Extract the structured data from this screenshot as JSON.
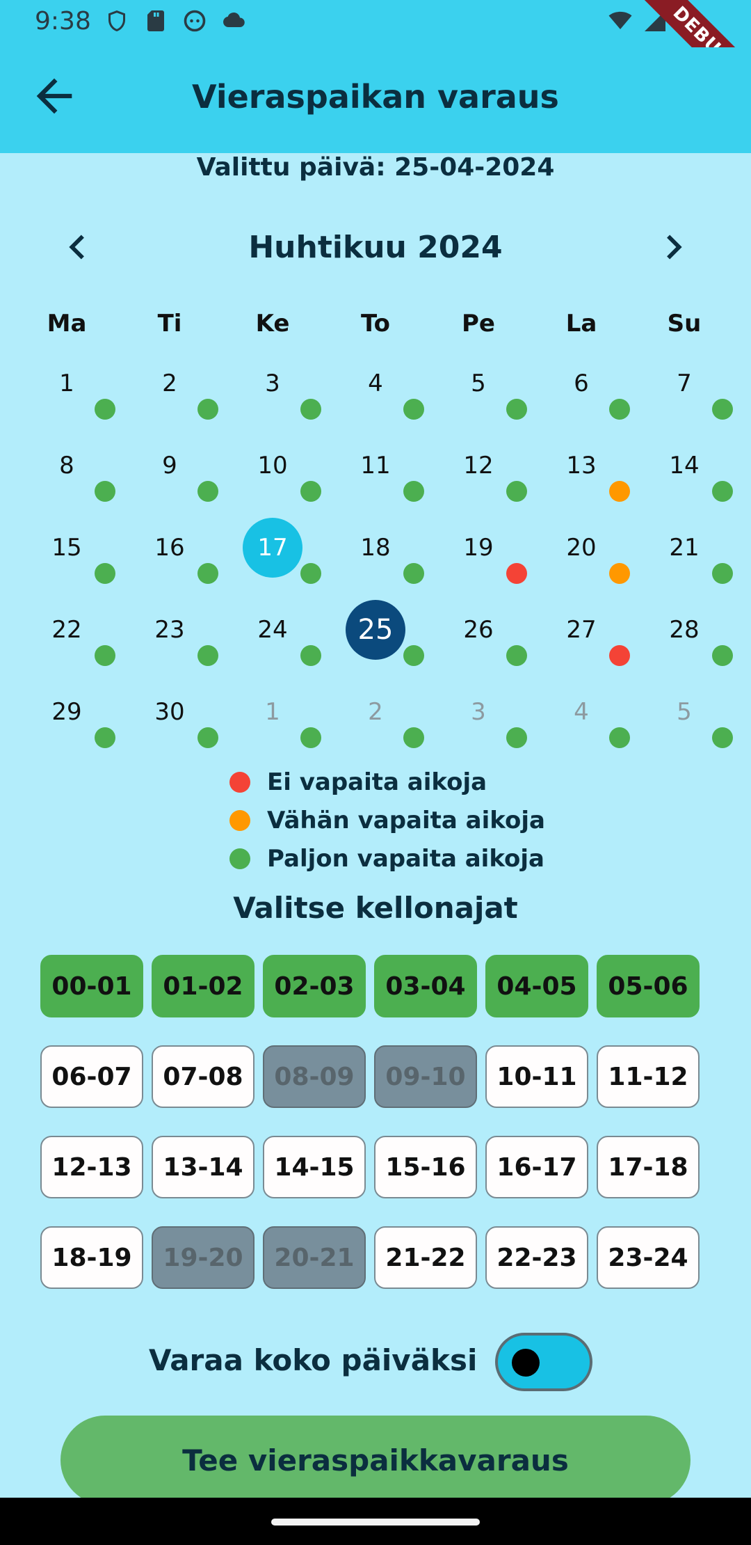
{
  "status_bar": {
    "time": "9:38",
    "debug_label": "DEBUG"
  },
  "app_bar": {
    "title": "Vieraspaikan varaus"
  },
  "selected_date": "Valittu päivä: 25-04-2024",
  "calendar": {
    "month_label": "Huhtikuu 2024",
    "weekdays": [
      "Ma",
      "Ti",
      "Ke",
      "To",
      "Pe",
      "La",
      "Su"
    ],
    "weeks": [
      [
        {
          "n": "1",
          "a": "many"
        },
        {
          "n": "2",
          "a": "many"
        },
        {
          "n": "3",
          "a": "many"
        },
        {
          "n": "4",
          "a": "many"
        },
        {
          "n": "5",
          "a": "many"
        },
        {
          "n": "6",
          "a": "many"
        },
        {
          "n": "7",
          "a": "many"
        }
      ],
      [
        {
          "n": "8",
          "a": "many"
        },
        {
          "n": "9",
          "a": "many"
        },
        {
          "n": "10",
          "a": "many"
        },
        {
          "n": "11",
          "a": "many"
        },
        {
          "n": "12",
          "a": "many"
        },
        {
          "n": "13",
          "a": "few"
        },
        {
          "n": "14",
          "a": "many"
        }
      ],
      [
        {
          "n": "15",
          "a": "many"
        },
        {
          "n": "16",
          "a": "many"
        },
        {
          "n": "17",
          "a": "many",
          "today": true
        },
        {
          "n": "18",
          "a": "many"
        },
        {
          "n": "19",
          "a": "none"
        },
        {
          "n": "20",
          "a": "few"
        },
        {
          "n": "21",
          "a": "many"
        }
      ],
      [
        {
          "n": "22",
          "a": "many"
        },
        {
          "n": "23",
          "a": "many"
        },
        {
          "n": "24",
          "a": "many"
        },
        {
          "n": "25",
          "a": "many",
          "selected": true
        },
        {
          "n": "26",
          "a": "many"
        },
        {
          "n": "27",
          "a": "none"
        },
        {
          "n": "28",
          "a": "many"
        }
      ],
      [
        {
          "n": "29",
          "a": "many"
        },
        {
          "n": "30",
          "a": "many"
        },
        {
          "n": "1",
          "a": "many",
          "muted": true
        },
        {
          "n": "2",
          "a": "many",
          "muted": true
        },
        {
          "n": "3",
          "a": "many",
          "muted": true
        },
        {
          "n": "4",
          "a": "many",
          "muted": true
        },
        {
          "n": "5",
          "a": "many",
          "muted": true
        }
      ]
    ]
  },
  "availability_colors": {
    "none": "#f44336",
    "few": "#ff9800",
    "many": "#4caf50"
  },
  "legend": [
    {
      "key": "none",
      "label": "Ei vapaita aikoja"
    },
    {
      "key": "few",
      "label": "Vähän vapaita aikoja"
    },
    {
      "key": "many",
      "label": "Paljon vapaita aikoja"
    }
  ],
  "times_title": "Valitse kellonajat",
  "time_slots": [
    {
      "label": "00-01",
      "state": "selected"
    },
    {
      "label": "01-02",
      "state": "selected"
    },
    {
      "label": "02-03",
      "state": "selected"
    },
    {
      "label": "03-04",
      "state": "selected"
    },
    {
      "label": "04-05",
      "state": "selected"
    },
    {
      "label": "05-06",
      "state": "selected"
    },
    {
      "label": "06-07",
      "state": "available"
    },
    {
      "label": "07-08",
      "state": "available"
    },
    {
      "label": "08-09",
      "state": "disabled"
    },
    {
      "label": "09-10",
      "state": "disabled"
    },
    {
      "label": "10-11",
      "state": "available"
    },
    {
      "label": "11-12",
      "state": "available"
    },
    {
      "label": "12-13",
      "state": "available"
    },
    {
      "label": "13-14",
      "state": "available"
    },
    {
      "label": "14-15",
      "state": "available"
    },
    {
      "label": "15-16",
      "state": "available"
    },
    {
      "label": "16-17",
      "state": "available"
    },
    {
      "label": "17-18",
      "state": "available"
    },
    {
      "label": "18-19",
      "state": "available"
    },
    {
      "label": "19-20",
      "state": "disabled"
    },
    {
      "label": "20-21",
      "state": "disabled"
    },
    {
      "label": "21-22",
      "state": "available"
    },
    {
      "label": "22-23",
      "state": "available"
    },
    {
      "label": "23-24",
      "state": "available"
    }
  ],
  "whole_day_toggle": {
    "label": "Varaa koko päiväksi",
    "on": false
  },
  "submit_label": "Tee vieraspaikkavaraus"
}
